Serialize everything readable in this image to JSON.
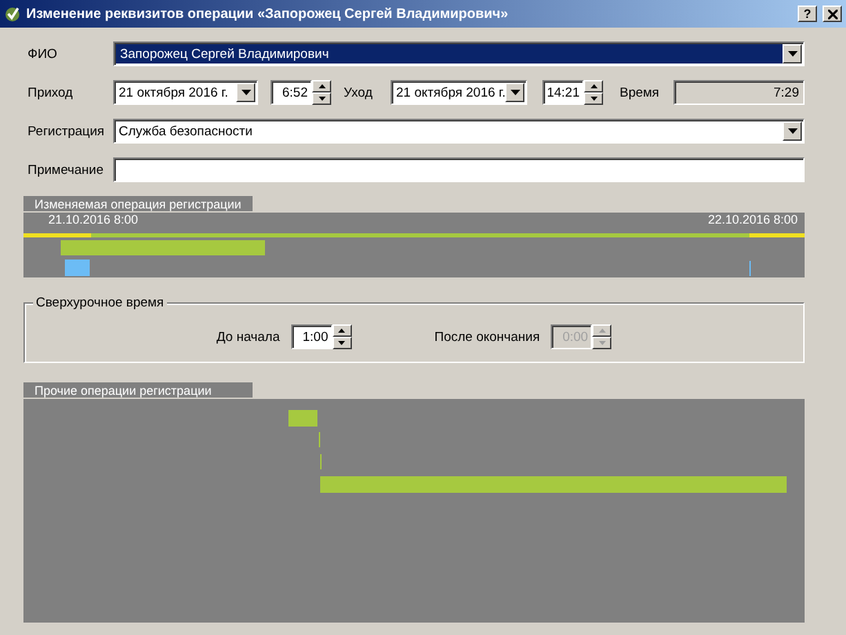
{
  "window": {
    "title": "Изменение реквизитов операции «Запорожец Сергей Владимирович»",
    "help_button": "?"
  },
  "fio": {
    "label": "ФИО",
    "value": "Запорожец Сергей Владимирович",
    "selected": true
  },
  "arrival": {
    "label": "Приход",
    "date": "21  октября  2016 г.",
    "time": "6:52"
  },
  "departure": {
    "label": "Уход",
    "date": "21  октября  2016 г.",
    "time": "14:21"
  },
  "duration": {
    "label": "Время",
    "value": "7:29",
    "disabled": true
  },
  "registration": {
    "label": "Регистрация",
    "value": "Служба безопасности",
    "selected": false
  },
  "note": {
    "label": "Примечание"
  },
  "timeline": {
    "title": "Изменяемая операция регистрации",
    "start_label": "21.10.2016 8:00",
    "end_label": "22.10.2016 8:00"
  },
  "overtime": {
    "title": "Сверхурочное время",
    "before": {
      "label": "До начала",
      "value": "1:00",
      "disabled": false
    },
    "after": {
      "label": "После окончания",
      "value": "0:00",
      "disabled": true
    }
  },
  "other_operations": {
    "title": "Прочие операции регистрации"
  }
}
